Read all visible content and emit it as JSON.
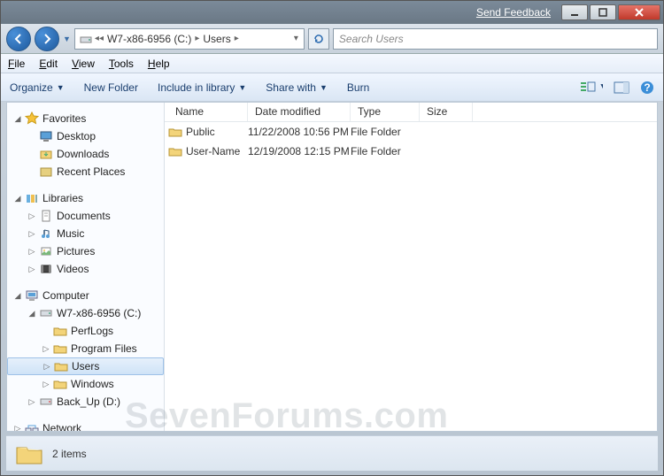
{
  "titlebar": {
    "feedback": "Send Feedback"
  },
  "address": {
    "crumb1": "W7-x86-6956 (C:)",
    "crumb2": "Users",
    "search_placeholder": "Search Users"
  },
  "menu": {
    "file": "File",
    "edit": "Edit",
    "view": "View",
    "tools": "Tools",
    "help": "Help"
  },
  "toolbar": {
    "organize": "Organize",
    "newfolder": "New Folder",
    "include": "Include in library",
    "sharewith": "Share with",
    "burn": "Burn"
  },
  "columns": {
    "name": "Name",
    "date": "Date modified",
    "type": "Type",
    "size": "Size"
  },
  "files": [
    {
      "name": "Public",
      "date": "11/22/2008 10:56 PM",
      "type": "File Folder"
    },
    {
      "name": "User-Name",
      "date": "12/19/2008 12:15 PM",
      "type": "File Folder"
    }
  ],
  "sidebar": {
    "favorites": "Favorites",
    "desktop": "Desktop",
    "downloads": "Downloads",
    "recent": "Recent Places",
    "libraries": "Libraries",
    "documents": "Documents",
    "music": "Music",
    "pictures": "Pictures",
    "videos": "Videos",
    "computer": "Computer",
    "cdrive": "W7-x86-6956 (C:)",
    "perflogs": "PerfLogs",
    "programfiles": "Program Files",
    "users": "Users",
    "windows": "Windows",
    "backup": "Back_Up (D:)",
    "network": "Network"
  },
  "status": {
    "count": "2 items"
  },
  "watermark": "SevenForums.com"
}
